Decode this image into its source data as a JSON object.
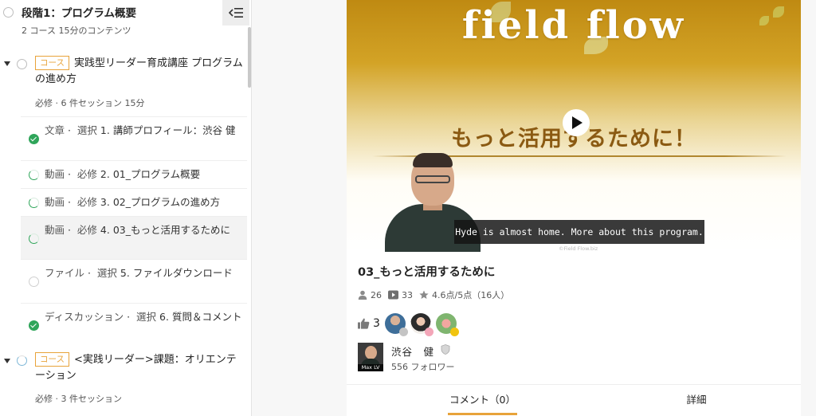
{
  "sidebar": {
    "stage": {
      "title": "段階1：プログラム概要",
      "subtitle": "2 コース 15分のコンテンツ"
    },
    "courses": [
      {
        "badge": "コース",
        "title": "実践型リーダー育成講座 プログラムの進め方",
        "meta": "必修 · 6 件セッション 15分",
        "items": [
          {
            "kind": "文章",
            "req": "選択",
            "title": "1. 講師プロフィール：渋谷 健",
            "status": "done"
          },
          {
            "kind": "動画",
            "req": "必修",
            "title": "2. 01_プログラム概要",
            "status": "progress"
          },
          {
            "kind": "動画",
            "req": "必修",
            "title": "3. 02_プログラムの進め方",
            "status": "progress"
          },
          {
            "kind": "動画",
            "req": "必修",
            "title": "4. 03_もっと活用するために",
            "status": "progress"
          },
          {
            "kind": "ファイル",
            "req": "選択",
            "title": "5. ファイルダウンロード",
            "status": "empty"
          },
          {
            "kind": "ディスカッション",
            "req": "選択",
            "title": "6. 質問＆コメント",
            "status": "done"
          }
        ]
      },
      {
        "badge": "コース",
        "title": "<実践リーダー>課題：オリエンテーション",
        "meta": "必修 · 3 件セッション"
      }
    ]
  },
  "video": {
    "logo_text": "field flow",
    "heading": "もっと活用するために！",
    "caption": "Hyde is almost home. More about this program.",
    "watermark": "©Field Flow.biz",
    "title": "03_もっと活用するために",
    "stats": {
      "views": "26",
      "videos": "33",
      "rating": "4.6点/5点（16人）"
    },
    "likes": "3"
  },
  "author": {
    "name": "渋谷　健",
    "followers": "556 フォロワー",
    "level": "Max LV"
  },
  "tabs": [
    {
      "label": "コメント（0）"
    },
    {
      "label": "詳細"
    }
  ],
  "colors": {
    "accent": "#e8a33a",
    "done": "#2fa55a"
  }
}
